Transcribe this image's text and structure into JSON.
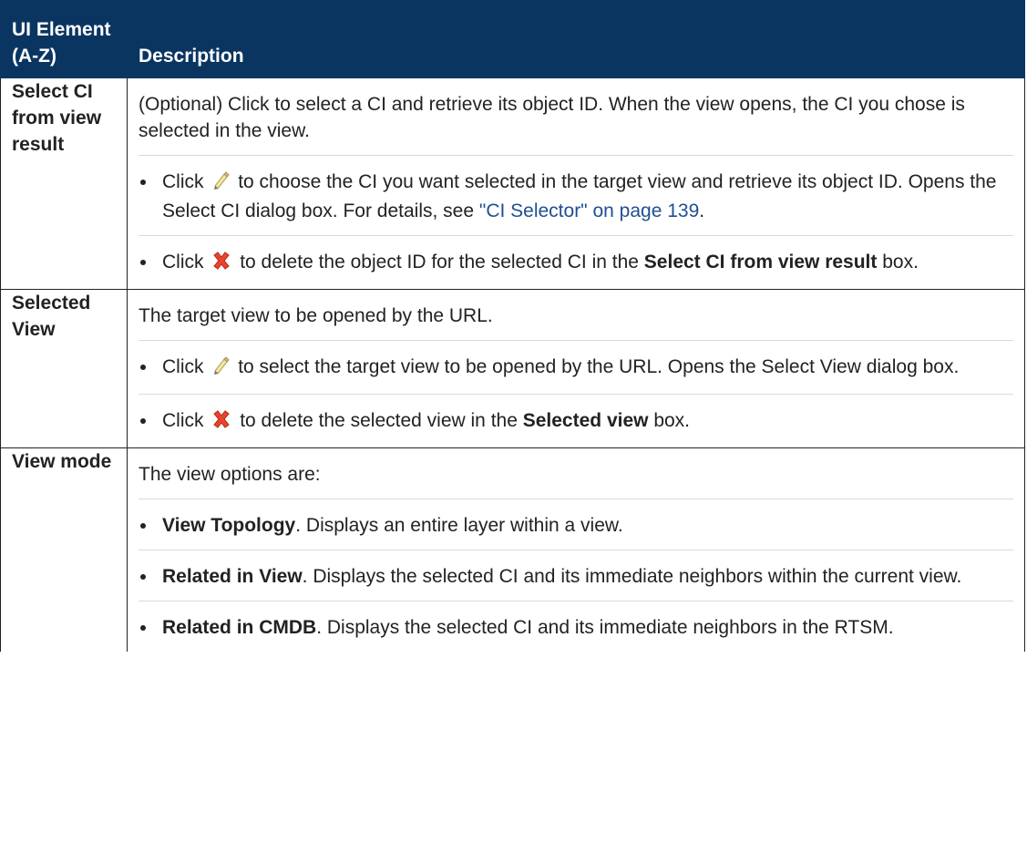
{
  "table": {
    "header_element": "UI Element (A-Z)",
    "header_description": "Description",
    "rows": [
      {
        "element": "Select CI from view result",
        "intro": "(Optional) Click to select a CI and retrieve its object ID. When the view opens, the CI you chose is selected in the view.",
        "bullets": [
          {
            "click": "Click",
            "icon": "pencil-icon",
            "text": "to choose the CI you want selected in the target view and retrieve its object ID. Opens the Select CI dialog box. For details, see",
            "link": "\"CI Selector\" on page 139",
            "end": "."
          },
          {
            "click": "Click",
            "icon": "delete-x-icon",
            "text": "to delete the object ID for the selected CI in the",
            "bold": "Select CI from view result",
            "end": "box."
          }
        ]
      },
      {
        "element": "Selected View",
        "intro": "The target view to be opened by the URL.",
        "bullets": [
          {
            "click": "Click",
            "icon": "pencil-icon",
            "text": "to select the target view to be opened by the URL. Opens the Select View dialog box."
          },
          {
            "click": "Click",
            "icon": "delete-x-icon",
            "text": "to delete the selected view in the",
            "bold": "Selected view",
            "end": "box."
          }
        ]
      },
      {
        "element": "View mode",
        "intro": "The view options are:",
        "options": [
          {
            "name": "View Topology",
            "text": ". Displays an entire layer within a view."
          },
          {
            "name": "Related in View",
            "text": ". Displays the selected CI and its immediate neighbors within the current view."
          },
          {
            "name": "Related in CMDB",
            "text": ". Displays the selected CI and its immediate neighbors in the RTSM."
          }
        ]
      }
    ]
  },
  "colors": {
    "header_bg": "#0b3561",
    "header_text": "#ffffff",
    "link": "#1f4f92",
    "delete_icon": "#e8452c"
  }
}
